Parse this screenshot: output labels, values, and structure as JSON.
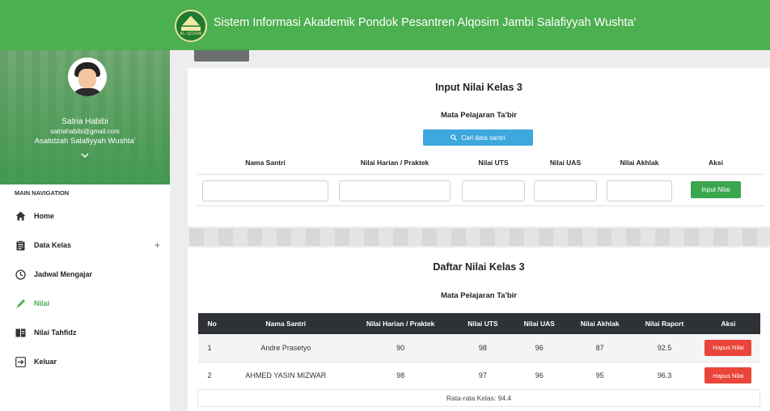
{
  "header": {
    "app_title": "Sistem Informasi Akademik Pondok Pesantren Alqosim Jambi Salafiyyah Wushta'",
    "logo_text": "AL-QOSIM",
    "brand_color": "#4caf50"
  },
  "profile": {
    "name": "Satria Habibi",
    "email": "satriahabibi@gmail.com",
    "role": "Asatidzah Salafiyyah Wushta'"
  },
  "nav": {
    "heading": "MAIN NAVIGATION",
    "items": [
      {
        "label": "Home",
        "icon": "home-icon"
      },
      {
        "label": "Data Kelas",
        "icon": "clipboard-icon",
        "expand": "+"
      },
      {
        "label": "Jadwal Mengajar",
        "icon": "clock-icon"
      },
      {
        "label": "Nilai",
        "icon": "pencil-icon",
        "active": true
      },
      {
        "label": "Nilai Tahfidz",
        "icon": "book-icon"
      },
      {
        "label": "Keluar",
        "icon": "logout-icon"
      }
    ]
  },
  "input_card": {
    "title": "Input Nilai Kelas 3",
    "subtitle": "Mata Pelajaran Ta'bir",
    "search_label": "Cari data santri",
    "columns": [
      "Nama Santri",
      "Nilai Harian / Praktek",
      "Nilai UTS",
      "Nilai UAS",
      "Nilai Akhlak",
      "Aksi"
    ],
    "fields": {
      "nama": "",
      "harian": "",
      "uts": "",
      "uas": "",
      "akhlak": ""
    },
    "submit_label": "Input Nilai"
  },
  "list_card": {
    "title": "Daftar Nilai Kelas 3",
    "subtitle": "Mata Pelajaran Ta'bir",
    "columns": [
      "No",
      "Nama Santri",
      "Nilai Harian / Praktek",
      "Nilai UTS",
      "Nilai UAS",
      "Nilai Akhlak",
      "Nilai Raport",
      "Aksi"
    ],
    "rows": [
      {
        "no": "1",
        "nama": "Andre Prasetyo",
        "harian": "90",
        "uts": "98",
        "uas": "96",
        "akhlak": "87",
        "raport": "92.5",
        "action": "Hapus Nilai"
      },
      {
        "no": "2",
        "nama": "AHMED YASIN MIZWAR",
        "harian": "98",
        "uts": "97",
        "uas": "96",
        "akhlak": "95",
        "raport": "96.3",
        "action": "Hapus Nilai"
      }
    ],
    "average": "Rata-rata Kelas: 94.4"
  }
}
